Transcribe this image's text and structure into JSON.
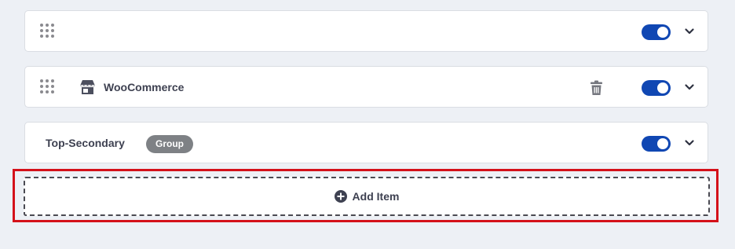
{
  "items": [
    {
      "label": "",
      "badge": "",
      "has_drag_handle": true,
      "icon": "",
      "has_delete": false,
      "enabled": true
    },
    {
      "label": "WooCommerce",
      "badge": "",
      "has_drag_handle": true,
      "icon": "store-icon",
      "has_delete": true,
      "enabled": true
    },
    {
      "label": "Top-Secondary",
      "badge": "Group",
      "has_drag_handle": false,
      "icon": "",
      "has_delete": false,
      "enabled": true
    }
  ],
  "add_item": {
    "label": "Add Item",
    "icon": "plus-circle-icon"
  },
  "colors": {
    "background": "#edf0f5",
    "toggle_on": "#1047b3",
    "badge": "#7e8185",
    "highlight": "#d4111a",
    "text": "#3e4151",
    "icon_muted": "#8a8a8f"
  }
}
